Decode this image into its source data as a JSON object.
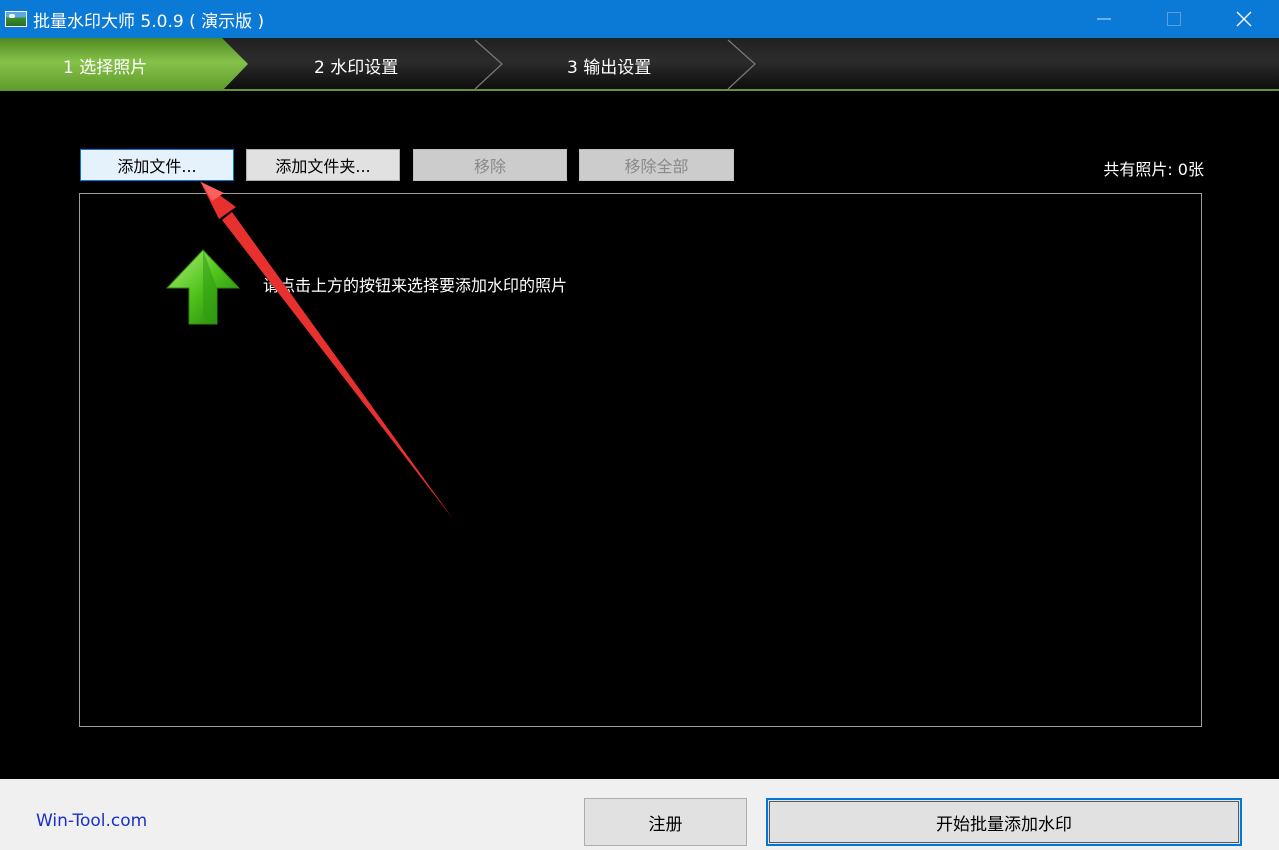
{
  "window": {
    "title": "批量水印大师 5.0.9 ( 演示版 )",
    "controls": [
      "minimize",
      "maximize",
      "close"
    ]
  },
  "steps": [
    {
      "label": "1 选择照片",
      "active": true
    },
    {
      "label": "2 水印设置",
      "active": false
    },
    {
      "label": "3 输出设置",
      "active": false
    }
  ],
  "toolbar": {
    "add_files": "添加文件...",
    "add_folder": "添加文件夹...",
    "remove": "移除",
    "remove_all": "移除全部"
  },
  "photo_count": "共有照片: 0张",
  "photo_list": {
    "hint": "请点击上方的按钮来选择要添加水印的照片",
    "hint_icon": "green-up-arrow-icon"
  },
  "footer": {
    "brand": "Win-Tool.com",
    "register": "注册",
    "start": "开始批量添加水印"
  },
  "colors": {
    "titlebar": "#0b79d6",
    "step_active": "#6fae3a",
    "background": "#000000",
    "annotation_arrow": "#e8312f",
    "brand_text": "#1a30c8"
  }
}
